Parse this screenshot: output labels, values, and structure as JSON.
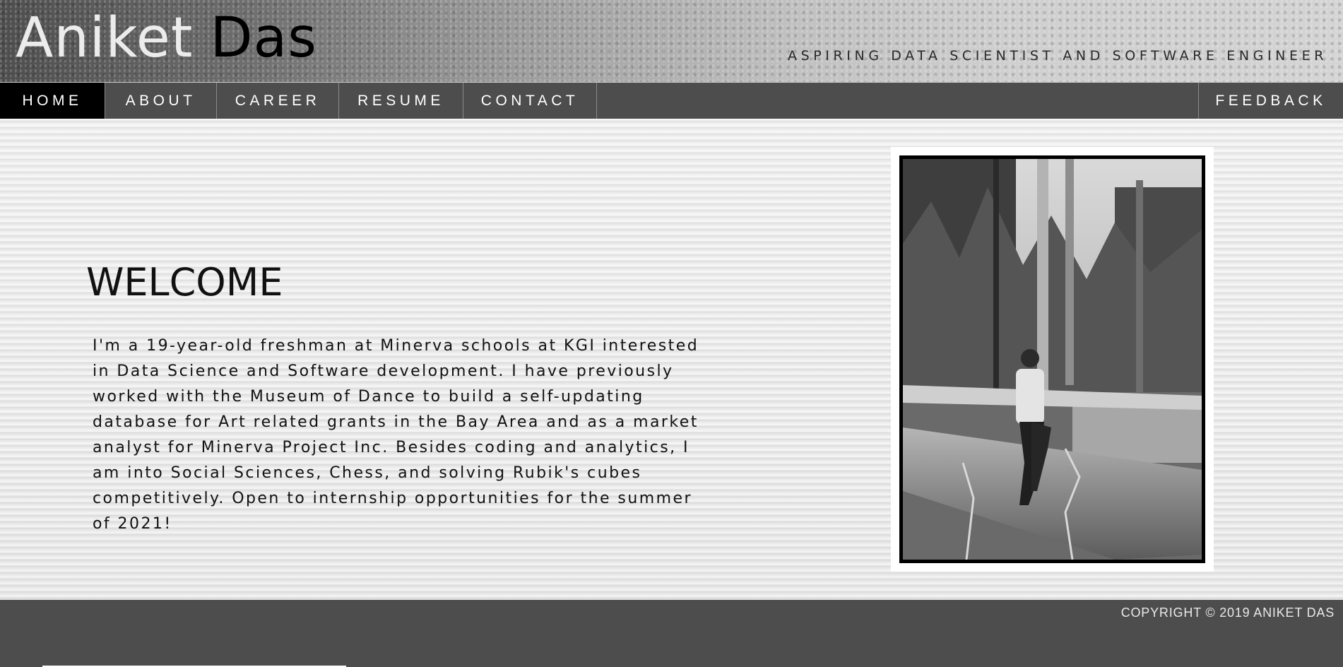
{
  "header": {
    "brand_first": "Aniket",
    "brand_last": "Das",
    "tagline": "ASPIRING DATA SCIENTIST AND SOFTWARE ENGINEER"
  },
  "nav": {
    "items": [
      {
        "label": "HOME",
        "active": true
      },
      {
        "label": "ABOUT",
        "active": false
      },
      {
        "label": "CAREER",
        "active": false
      },
      {
        "label": "RESUME",
        "active": false
      },
      {
        "label": "CONTACT",
        "active": false
      }
    ],
    "feedback_label": "FEEDBACK"
  },
  "main": {
    "title": "WELCOME",
    "body": "I'm a 19-year-old freshman at Minerva schools at KGI interested in Data Science and Software development. I have previously worked with the Museum of Dance to build a self-updating database for Art related grants in the Bay Area and as a market analyst for Minerva Project Inc. Besides coding and analytics, I am into Social Sciences, Chess, and solving Rubik's cubes competitively. Open to internship opportunities for the summer of 2021!"
  },
  "footer": {
    "copyright": "COPYRIGHT © 2019 ANIKET DAS"
  },
  "colors": {
    "nav_bg": "#4d4d4d",
    "nav_active_bg": "#000000",
    "footer_bg": "#4d4d4d"
  }
}
